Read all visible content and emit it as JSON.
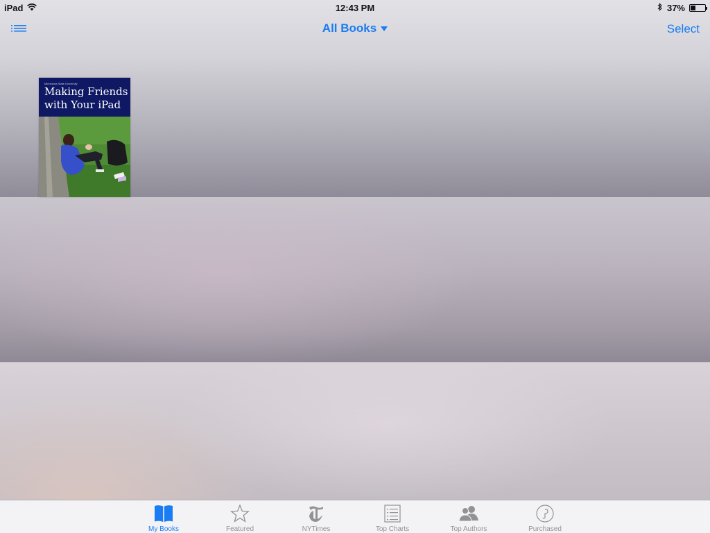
{
  "status_bar": {
    "device": "iPad",
    "time": "12:43 PM",
    "battery": "37%",
    "battery_level": 0.37
  },
  "nav": {
    "title": "All Books",
    "select_label": "Select"
  },
  "books": [
    {
      "publisher": "Minnesota State University",
      "title_lines": [
        "Making Friends",
        "with Your iPad"
      ]
    }
  ],
  "tabs": [
    {
      "label": "My Books",
      "icon": "book-icon",
      "active": true
    },
    {
      "label": "Featured",
      "icon": "star-icon",
      "active": false
    },
    {
      "label": "NYTimes",
      "icon": "nytimes-icon",
      "active": false
    },
    {
      "label": "Top Charts",
      "icon": "list-icon",
      "active": false
    },
    {
      "label": "Top Authors",
      "icon": "people-icon",
      "active": false
    },
    {
      "label": "Purchased",
      "icon": "purchased-icon",
      "active": false
    }
  ],
  "colors": {
    "accent": "#1a7cf3",
    "tab_inactive": "#929292",
    "book_header": "#0e1863"
  }
}
